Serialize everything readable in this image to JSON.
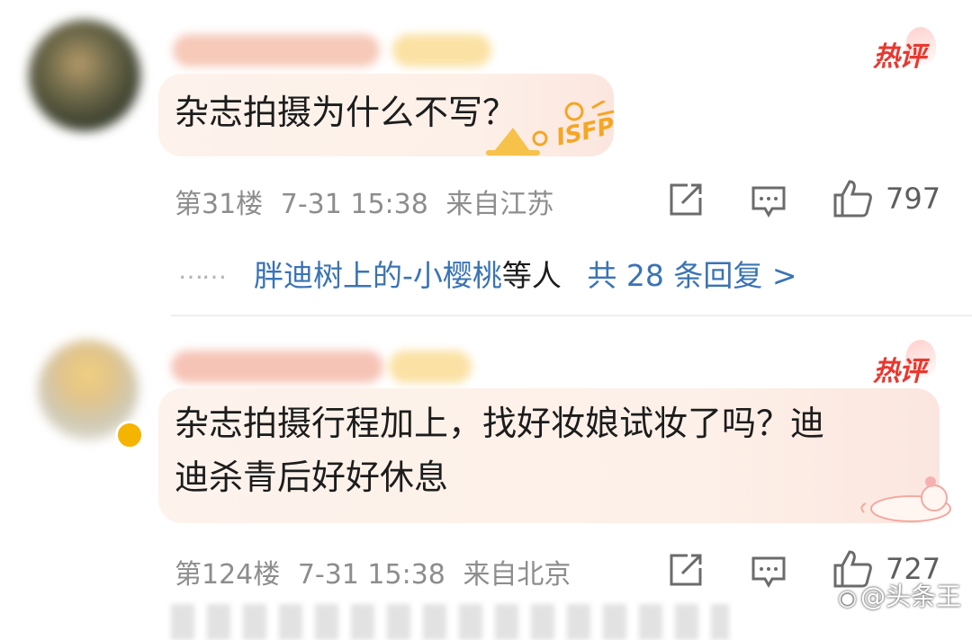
{
  "comments": [
    {
      "hot_label": "热评",
      "text": "杂志拍摄为什么不写？",
      "badge": "ISFP",
      "floor": "第31楼",
      "date": "7-31 15:38",
      "location": "来自江苏",
      "likes": "797",
      "replies": {
        "dots": "……",
        "user": "胖迪树上的-小樱桃",
        "suffix": "等人",
        "total": "共 28 条回复 >"
      }
    },
    {
      "hot_label": "热评",
      "text_line1": "杂志拍摄行程加上，找好妆娘试妆了吗？迪",
      "text_line2": "迪杀青后好好休息",
      "floor": "第124楼",
      "date": "7-31 15:38",
      "location": "来自北京",
      "likes": "727"
    }
  ],
  "watermark": {
    "icon": "weibo-icon",
    "text": "@头条王"
  },
  "colors": {
    "hot": "#e8382f",
    "link": "#3a73b5",
    "meta": "#8d8d8d",
    "bubble": "#fdf3ec"
  }
}
